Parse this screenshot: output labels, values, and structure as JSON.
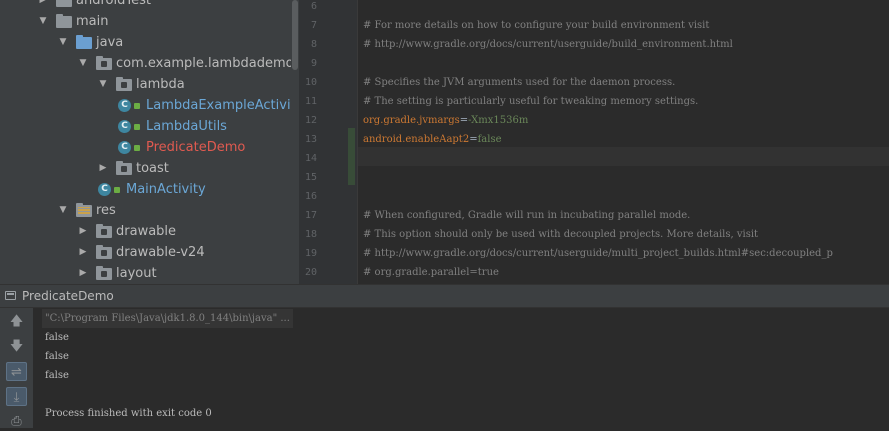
{
  "project_tree": {
    "items": [
      {
        "label": "androidTest",
        "type": "folder",
        "expanded": false,
        "indent": 1
      },
      {
        "label": "main",
        "type": "folder",
        "expanded": true,
        "indent": 1
      },
      {
        "label": "java",
        "type": "source-folder",
        "expanded": true,
        "indent": 2
      },
      {
        "label": "com.example.lambdademo",
        "type": "package",
        "expanded": true,
        "indent": 3
      },
      {
        "label": "lambda",
        "type": "package",
        "expanded": true,
        "indent": 4
      },
      {
        "label": "LambdaExampleActivit",
        "type": "class",
        "indent": 5
      },
      {
        "label": "LambdaUtils",
        "type": "class",
        "indent": 5
      },
      {
        "label": "PredicateDemo",
        "type": "class",
        "highlight": true,
        "indent": 5
      },
      {
        "label": "toast",
        "type": "package",
        "expanded": false,
        "indent": 4
      },
      {
        "label": "MainActivity",
        "type": "class",
        "indent": 4
      },
      {
        "label": "res",
        "type": "res-folder",
        "expanded": true,
        "indent": 2
      },
      {
        "label": "drawable",
        "type": "package",
        "expanded": false,
        "indent": 3
      },
      {
        "label": "drawable-v24",
        "type": "package",
        "expanded": false,
        "indent": 3
      },
      {
        "label": "layout",
        "type": "package",
        "expanded": false,
        "indent": 3
      }
    ],
    "class_icon_letter": "C"
  },
  "editor": {
    "lines": [
      {
        "num": "6",
        "text": ""
      },
      {
        "num": "7",
        "text": "# For more details on how to configure your build environment visit"
      },
      {
        "num": "8",
        "text": "# http://www.gradle.org/docs/current/userguide/build_environment.html"
      },
      {
        "num": "9",
        "text": ""
      },
      {
        "num": "10",
        "text": "# Specifies the JVM arguments used for the daemon process."
      },
      {
        "num": "11",
        "text": "# The setting is particularly useful for tweaking memory settings."
      },
      {
        "num": "12",
        "key": "org.gradle.jvmargs",
        "value": "-Xmx1536m"
      },
      {
        "num": "13",
        "key": "android.enableAapt2",
        "value": "false"
      },
      {
        "num": "14",
        "text": ""
      },
      {
        "num": "15",
        "text": ""
      },
      {
        "num": "16",
        "text": ""
      },
      {
        "num": "17",
        "text": "# When configured, Gradle will run in incubating parallel mode."
      },
      {
        "num": "18",
        "text": "# This option should only be used with decoupled projects. More details, visit"
      },
      {
        "num": "19",
        "text": "# http://www.gradle.org/docs/current/userguide/multi_project_builds.html#sec:decoupled_p"
      },
      {
        "num": "20",
        "text": "# org.gradle.parallel=true"
      }
    ]
  },
  "run_panel": {
    "tab_label": "PredicateDemo",
    "tools": [
      {
        "name": "up-arrow-icon",
        "glyph": "🡅"
      },
      {
        "name": "down-arrow-icon",
        "glyph": "🡇"
      },
      {
        "name": "soft-wrap-icon",
        "glyph": "⇌"
      },
      {
        "name": "scroll-to-end-icon",
        "glyph": "⤓"
      },
      {
        "name": "print-icon",
        "glyph": "⎙"
      }
    ],
    "console_lines": [
      "\"C:\\Program Files\\Java\\jdk1.8.0_144\\bin\\java\" ...",
      "false",
      "false",
      "false",
      "",
      "Process finished with exit code 0"
    ]
  },
  "colors": {
    "class_name": "#6ba7d6",
    "class_name_highlight": "#e05a50",
    "comment": "#808080",
    "property_key": "#cc7832",
    "property_value": "#6a8759"
  }
}
